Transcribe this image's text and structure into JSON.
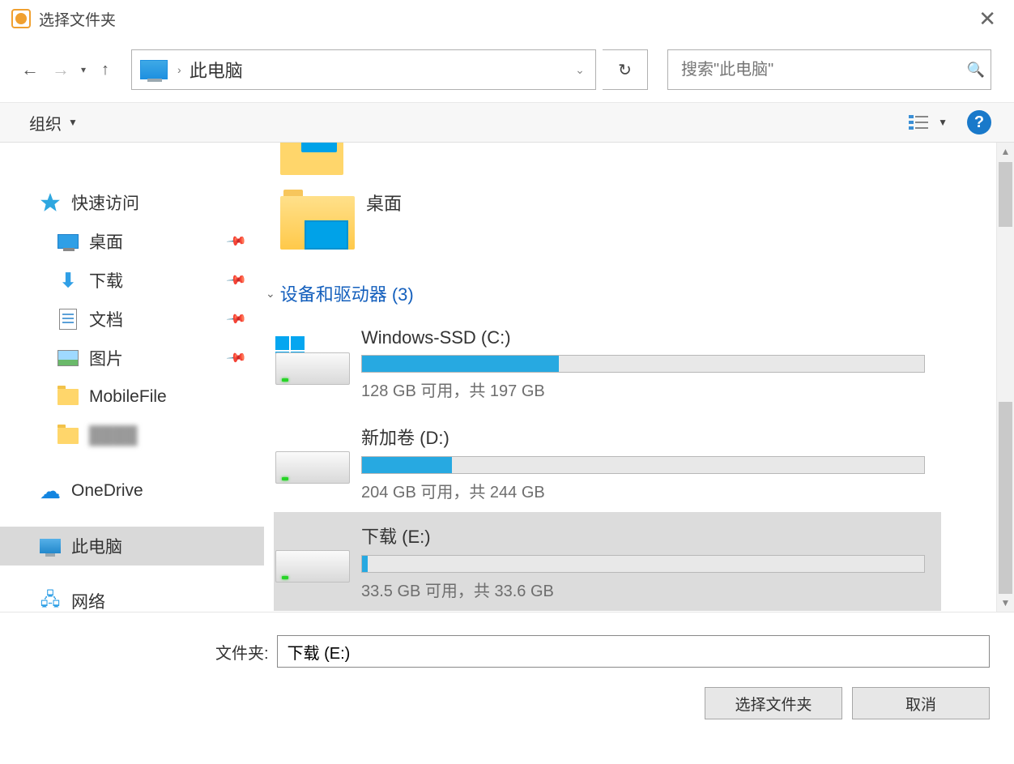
{
  "title": "选择文件夹",
  "breadcrumb": {
    "current": "此电脑"
  },
  "search": {
    "placeholder": "搜索\"此电脑\""
  },
  "toolbar": {
    "organize": "组织"
  },
  "sidebar": {
    "quick_access": "快速访问",
    "desktop": "桌面",
    "downloads": "下载",
    "documents": "文档",
    "pictures": "图片",
    "mobilefile": "MobileFile",
    "redacted": "████",
    "onedrive": "OneDrive",
    "this_pc": "此电脑",
    "network": "网络"
  },
  "content": {
    "desktop_tile": "桌面",
    "group_header": "设备和驱动器 (3)",
    "drives": [
      {
        "name": "Windows-SSD (C:)",
        "status": "128 GB 可用，共 197 GB",
        "fill_pct": 35
      },
      {
        "name": "新加卷 (D:)",
        "status": "204 GB 可用，共 244 GB",
        "fill_pct": 16
      },
      {
        "name": "下载 (E:)",
        "status": "33.5 GB 可用，共 33.6 GB",
        "fill_pct": 1
      }
    ]
  },
  "footer": {
    "folder_label": "文件夹:",
    "folder_value": "下载 (E:)",
    "select_btn": "选择文件夹",
    "cancel_btn": "取消"
  }
}
